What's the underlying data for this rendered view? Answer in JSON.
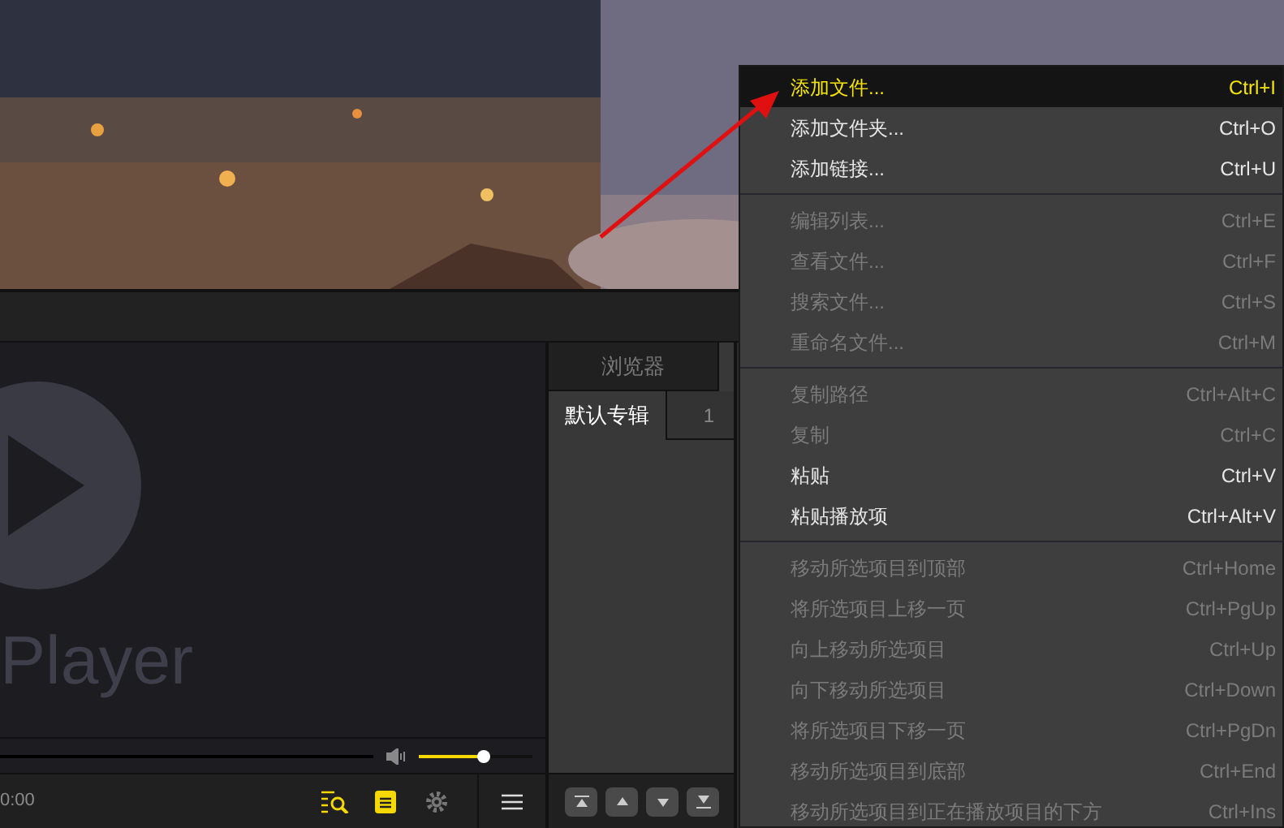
{
  "player": {
    "logo_text": "Player",
    "time": "0:00",
    "volume": {
      "level": 0.57
    }
  },
  "sidebar": {
    "tab": "浏览器",
    "playlists": [
      {
        "name": "默认专辑",
        "count": "1",
        "selected": true
      }
    ]
  },
  "context_menu": {
    "groups": [
      [
        {
          "label": "添加文件...",
          "shortcut": "Ctrl+I",
          "disabled": false,
          "selected": true
        },
        {
          "label": "添加文件夹...",
          "shortcut": "Ctrl+O",
          "disabled": false,
          "selected": false
        },
        {
          "label": "添加链接...",
          "shortcut": "Ctrl+U",
          "disabled": false,
          "selected": false
        }
      ],
      [
        {
          "label": "编辑列表...",
          "shortcut": "Ctrl+E",
          "disabled": true,
          "selected": false
        },
        {
          "label": "查看文件...",
          "shortcut": "Ctrl+F",
          "disabled": true,
          "selected": false
        },
        {
          "label": "搜索文件...",
          "shortcut": "Ctrl+S",
          "disabled": true,
          "selected": false
        },
        {
          "label": "重命名文件...",
          "shortcut": "Ctrl+M",
          "disabled": true,
          "selected": false
        }
      ],
      [
        {
          "label": "复制路径",
          "shortcut": "Ctrl+Alt+C",
          "disabled": true,
          "selected": false
        },
        {
          "label": "复制",
          "shortcut": "Ctrl+C",
          "disabled": true,
          "selected": false
        },
        {
          "label": "粘贴",
          "shortcut": "Ctrl+V",
          "disabled": false,
          "selected": false
        },
        {
          "label": "粘贴播放项",
          "shortcut": "Ctrl+Alt+V",
          "disabled": false,
          "selected": false
        }
      ],
      [
        {
          "label": "移动所选项目到顶部",
          "shortcut": "Ctrl+Home",
          "disabled": true,
          "selected": false
        },
        {
          "label": "将所选项目上移一页",
          "shortcut": "Ctrl+PgUp",
          "disabled": true,
          "selected": false
        },
        {
          "label": "向上移动所选项目",
          "shortcut": "Ctrl+Up",
          "disabled": true,
          "selected": false
        },
        {
          "label": "向下移动所选项目",
          "shortcut": "Ctrl+Down",
          "disabled": true,
          "selected": false
        },
        {
          "label": "将所选项目下移一页",
          "shortcut": "Ctrl+PgDn",
          "disabled": true,
          "selected": false
        },
        {
          "label": "移动所选项目到底部",
          "shortcut": "Ctrl+End",
          "disabled": true,
          "selected": false
        },
        {
          "label": "移动所选项目到正在播放项目的下方",
          "shortcut": "Ctrl+Ins",
          "disabled": true,
          "selected": false
        }
      ]
    ]
  }
}
